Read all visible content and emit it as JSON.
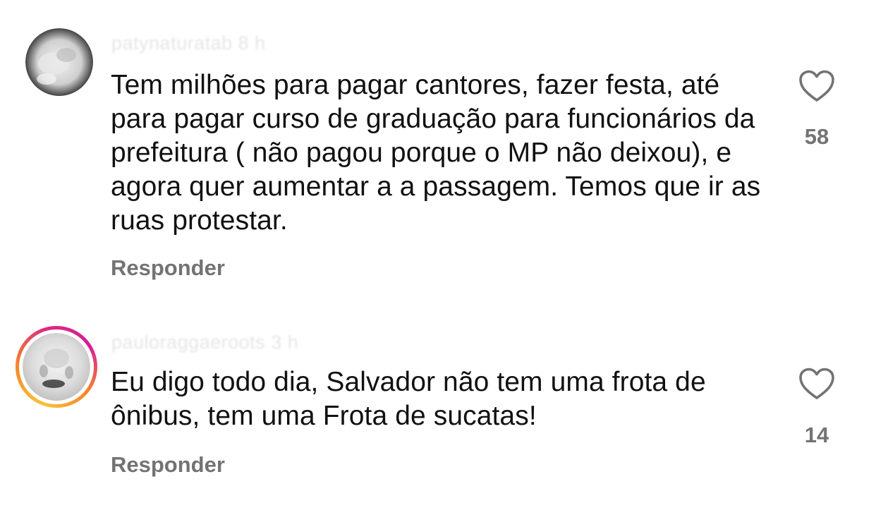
{
  "comments": [
    {
      "username": "patynaturatab",
      "time": "8 h",
      "text": "Tem milhões para pagar cantores, fazer festa, até para pagar curso de graduação para funcionários da prefeitura ( não pagou porque o MP não deixou), e agora quer aumentar a a passagem. Temos que ir as ruas protestar.",
      "reply_label": "Responder",
      "like_count": "58",
      "like_icon": "heart-outline-icon"
    },
    {
      "username": "pauloraggaeroots",
      "time": "3 h",
      "text": "Eu digo todo dia, Salvador não tem uma frota de ônibus, tem uma Frota de sucatas!",
      "reply_label": "Responder",
      "like_count": "14",
      "like_icon": "heart-outline-icon"
    }
  ],
  "colors": {
    "text": "#111111",
    "secondary": "#737373",
    "story_ring_start": "#f9c33b",
    "story_ring_end": "#d91a9b"
  }
}
